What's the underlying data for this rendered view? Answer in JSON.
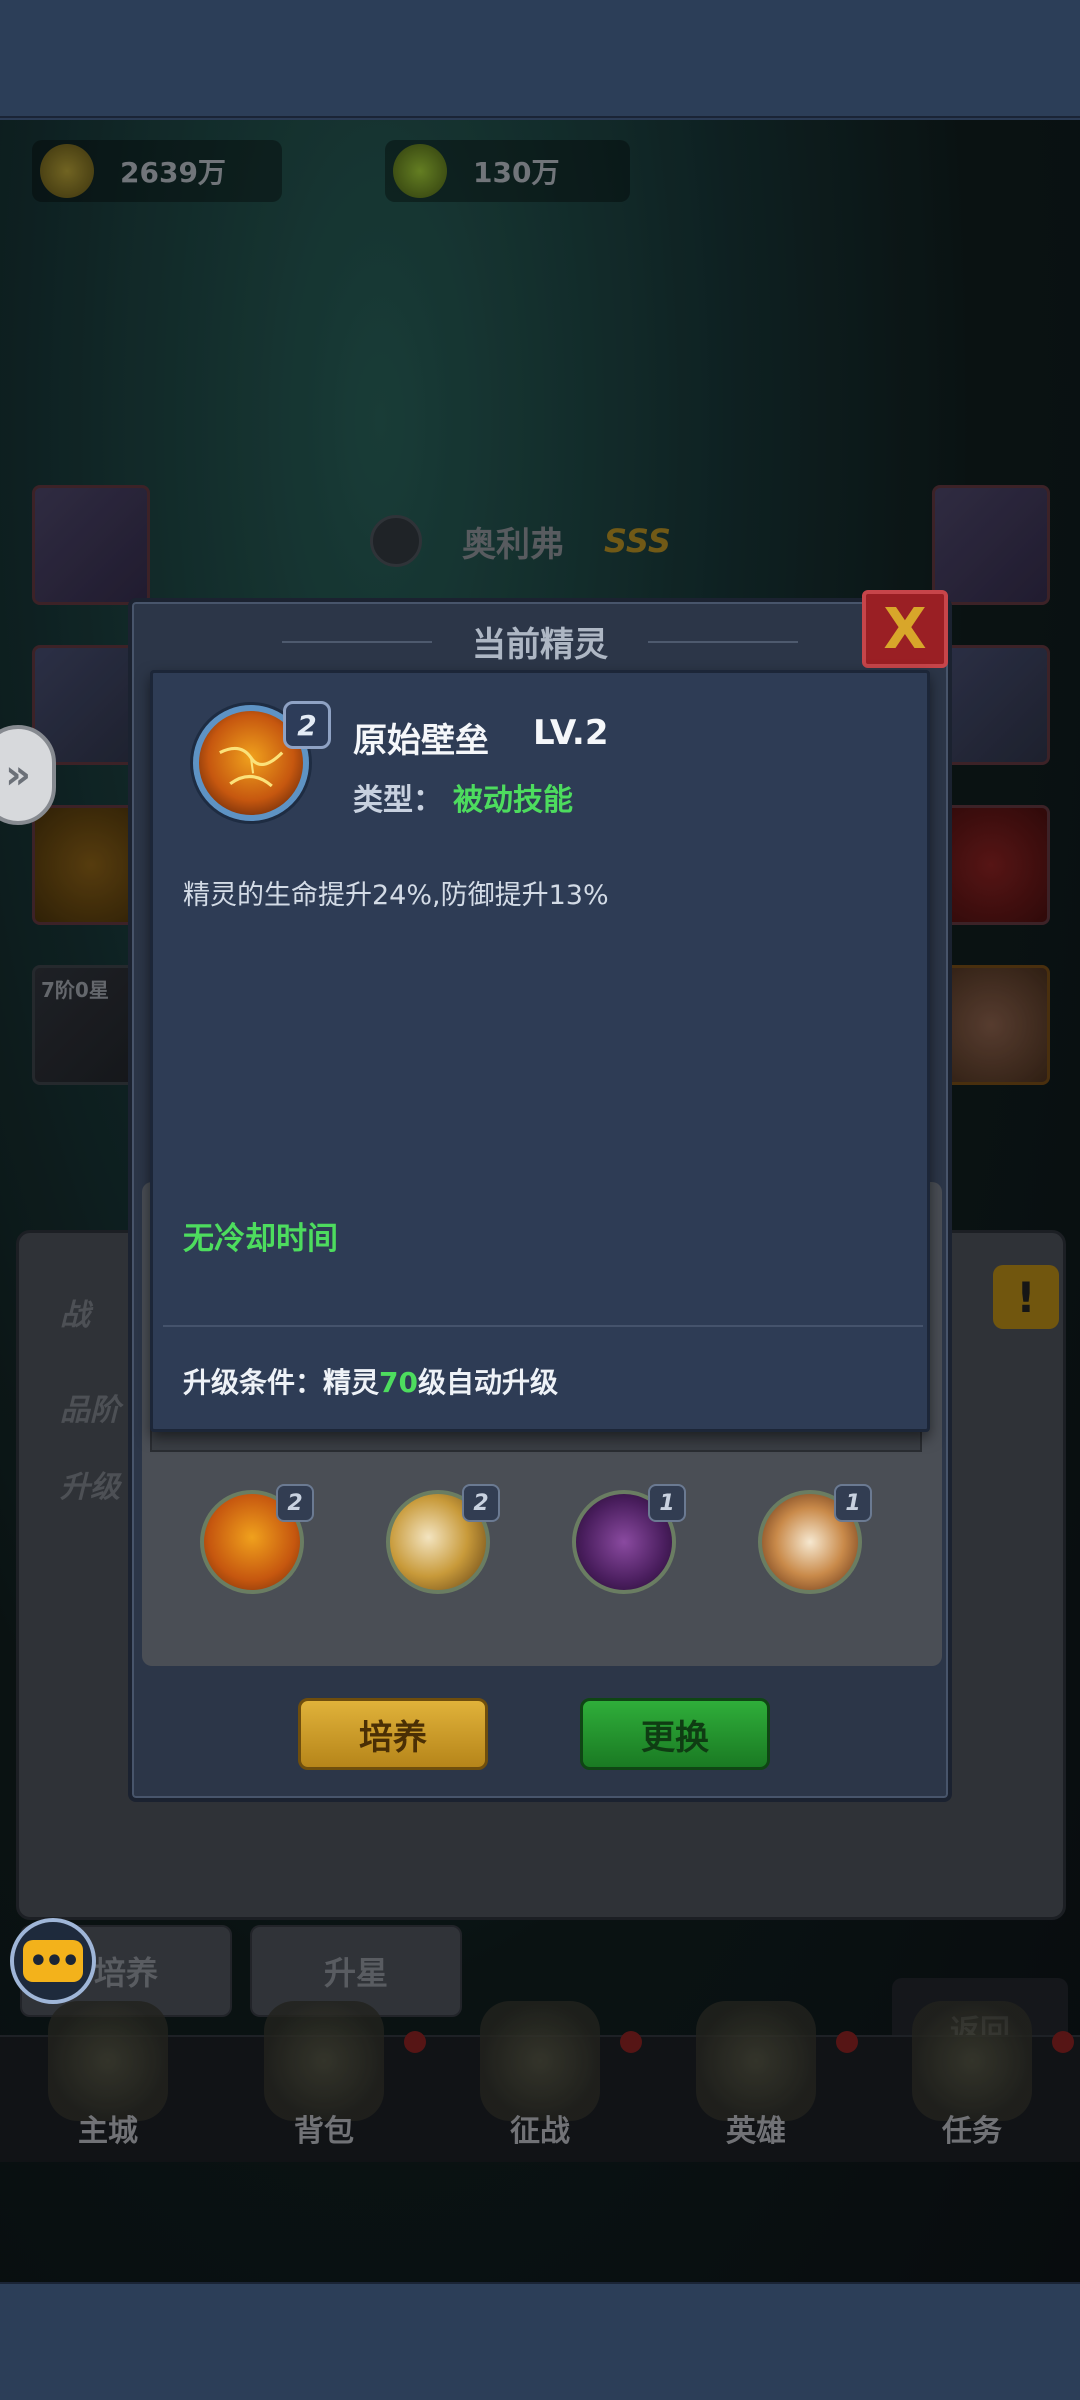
{
  "currency": {
    "gold": "2639万",
    "gems": "130万"
  },
  "hero": {
    "name": "奥利弗",
    "rank": "SSS"
  },
  "background_labels": {
    "stage_label": "7阶0星",
    "quality_label": "品阶",
    "upgrade_label": "升级",
    "battle_label": "战",
    "culture_tab": "培养",
    "star_tab": "升星",
    "back": "返回"
  },
  "bottom_nav": [
    {
      "label": "主城"
    },
    {
      "label": "背包"
    },
    {
      "label": "征战"
    },
    {
      "label": "英雄"
    },
    {
      "label": "任务"
    }
  ],
  "dialog": {
    "title": "当前精灵",
    "close_label": "X",
    "skills": [
      {
        "level": "2"
      },
      {
        "level": "2"
      },
      {
        "level": "1"
      },
      {
        "level": "1"
      }
    ],
    "buttons": {
      "culture": "培养",
      "change": "更换"
    }
  },
  "info_card": {
    "level_badge": "2",
    "skill_name": "原始壁垒",
    "skill_level": "LV.2",
    "type_label": "类型：",
    "type_value": "被动技能",
    "description": "精灵的生命提升24%,防御提升13%",
    "cooldown": "无冷却时间",
    "upgrade_prefix": "升级条件：精灵",
    "upgrade_level": "70",
    "upgrade_suffix": "级自动升级"
  },
  "colors": {
    "accent_green": "#4ddc5e",
    "card_bg": "#2e3c55",
    "gold_button": "#e0b23a",
    "green_button": "#2fae3a",
    "close_red": "#9a1f24"
  }
}
